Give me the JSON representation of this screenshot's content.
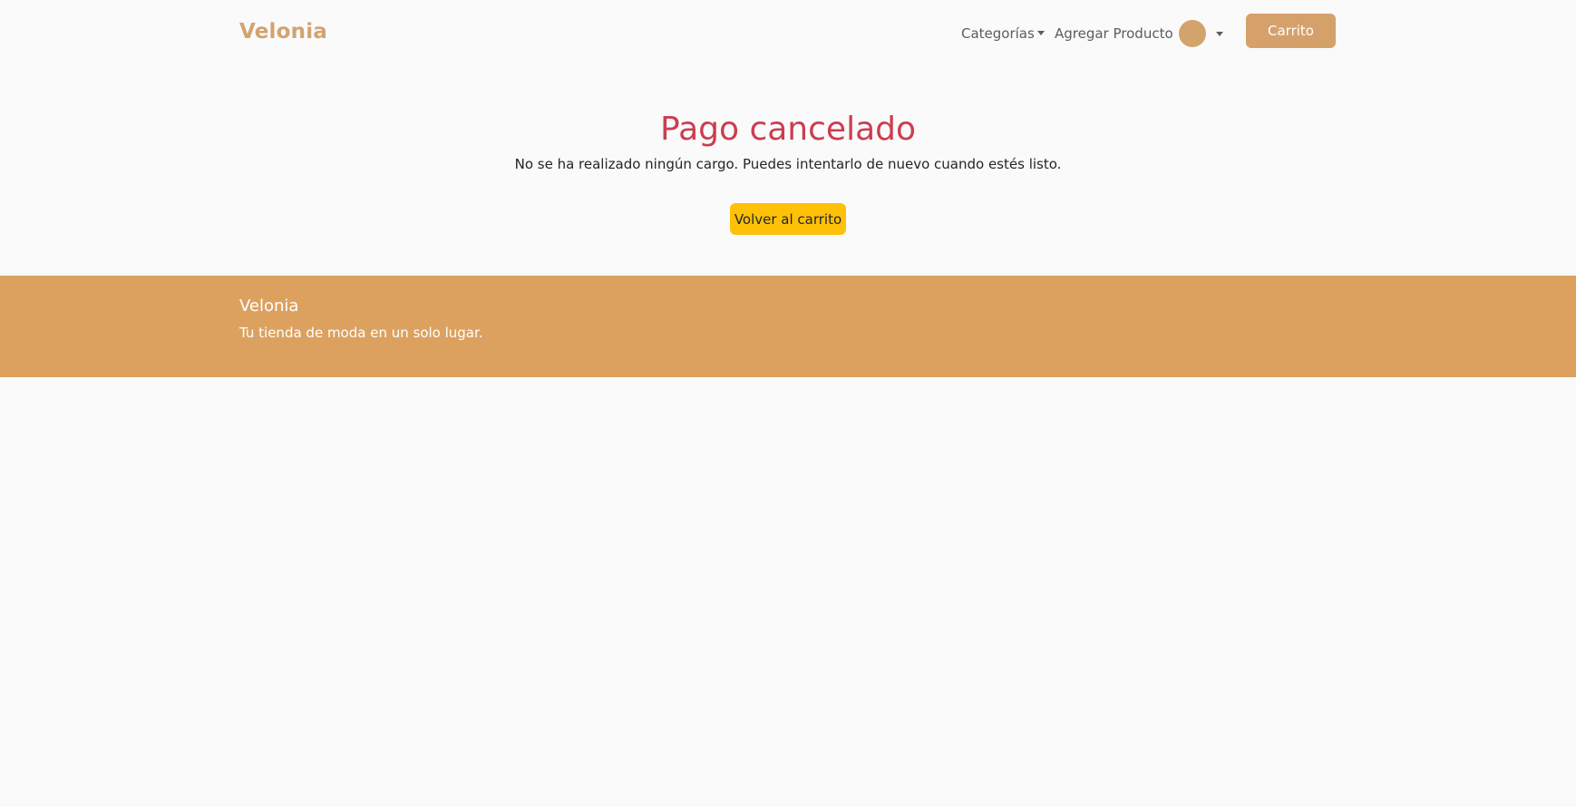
{
  "navbar": {
    "brand": "Velonia",
    "categorias_label": "Categorías",
    "agregar_label": "Agregar Producto",
    "cart_label": "Carrito"
  },
  "main": {
    "title": "Pago cancelado",
    "message": "No se ha realizado ningún cargo. Puedes intentarlo de nuevo cuando estés listo.",
    "back_button_label": "Volver al carrito"
  },
  "footer": {
    "title": "Velonia",
    "tagline": "Tu tienda de moda en un solo lugar."
  },
  "colors": {
    "brand": "#d3a36e",
    "cart_button": "#d6a06a",
    "title_red": "#cc3d50",
    "back_button": "#ffc107",
    "footer_bg": "#dca15f",
    "page_bg": "#fafafa"
  },
  "icons": {
    "avatar": "user-avatar-circle",
    "dropdown": "caret-down-icon"
  }
}
